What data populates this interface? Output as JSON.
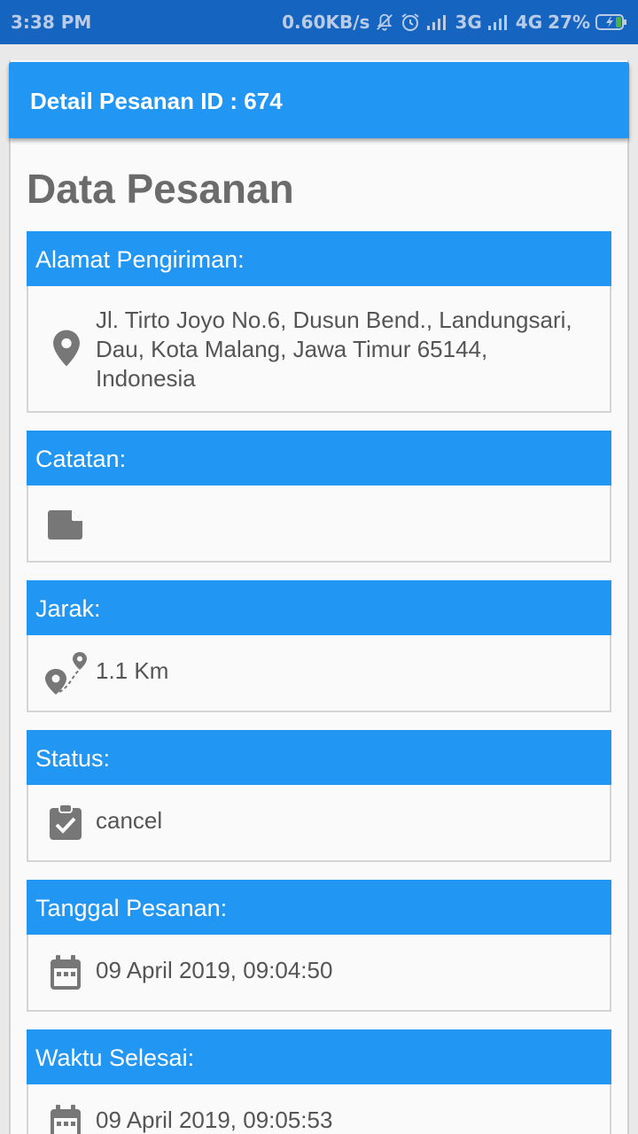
{
  "status_bar": {
    "time": "3:38 PM",
    "net_speed": "0.60KB/s",
    "network_1": "3G",
    "network_2": "4G",
    "battery": "27%"
  },
  "appbar": {
    "title": "Detail Pesanan ID : 674"
  },
  "page_title": "Data Pesanan",
  "sections": [
    {
      "label": "Alamat Pengiriman:",
      "icon": "location-pin-icon",
      "value": "Jl. Tirto Joyo No.6, Dusun Bend., Landungsari, Dau, Kota Malang, Jawa Timur 65144, Indonesia"
    },
    {
      "label": "Catatan:",
      "icon": "note-icon",
      "value": ""
    },
    {
      "label": "Jarak:",
      "icon": "route-distance-icon",
      "value": "1.1 Km"
    },
    {
      "label": "Status:",
      "icon": "clipboard-check-icon",
      "value": "cancel"
    },
    {
      "label": "Tanggal Pesanan:",
      "icon": "calendar-icon",
      "value": "09 April 2019, 09:04:50"
    },
    {
      "label": "Waktu Selesai:",
      "icon": "calendar-icon",
      "value": "09 April 2019, 09:05:53"
    }
  ],
  "colors": {
    "status_bar": "#1565c0",
    "primary": "#2196f3",
    "icon": "#777777",
    "text": "#555555"
  }
}
